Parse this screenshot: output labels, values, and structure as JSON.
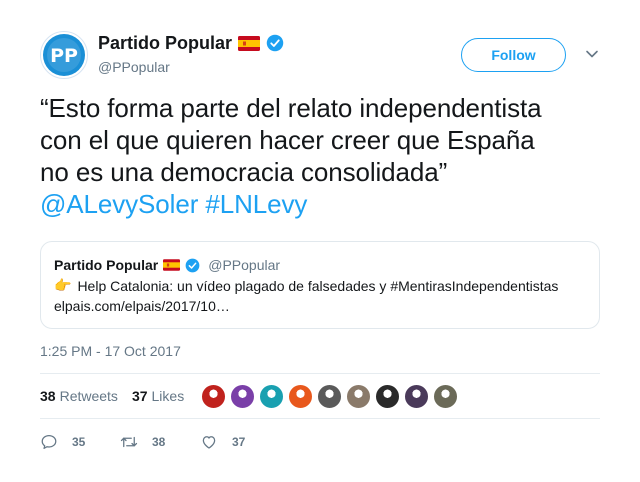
{
  "author": {
    "display_name": "Partido Popular",
    "handle": "@PPopular",
    "avatar_text": "PP",
    "flag_icon": "spain-flag-icon",
    "verified_icon": "verified-badge-icon"
  },
  "follow_label": "Follow",
  "menu_icon": "chevron-down-icon",
  "tweet": {
    "text_line1": "“Esto forma parte del relato independentista",
    "text_line2": "con el que quieren hacer creer que España",
    "text_line3": "no es una democracia consolidada”",
    "mention": "@ALevySoler",
    "hashtag": "#LNLevy"
  },
  "quoted": {
    "display_name": "Partido Popular",
    "handle": "@PPopular",
    "emoji": "👉",
    "text": "Help Catalonia: un vídeo plagado de falsedades y #MentirasIndependentistas",
    "link": "elpais.com/elpais/2017/10…"
  },
  "timestamp": "1:25 PM - 17 Oct 2017",
  "stats": {
    "retweets_count": "38",
    "retweets_label": "Retweets",
    "likes_count": "37",
    "likes_label": "Likes"
  },
  "likers": [
    {
      "color": "#c0221d"
    },
    {
      "color": "#7a3fa8"
    },
    {
      "color": "#19a0b0"
    },
    {
      "color": "#e8581c"
    },
    {
      "color": "#5a5a5a"
    },
    {
      "color": "#8a7a6a"
    },
    {
      "color": "#2a2a2a"
    },
    {
      "color": "#4a3a5a"
    },
    {
      "color": "#6b6a58"
    }
  ],
  "actions": {
    "reply_count": "35",
    "retweet_count": "38",
    "like_count": "37"
  },
  "colors": {
    "accent": "#1da1f2",
    "brand": "#0a77c0",
    "muted": "#657786"
  }
}
